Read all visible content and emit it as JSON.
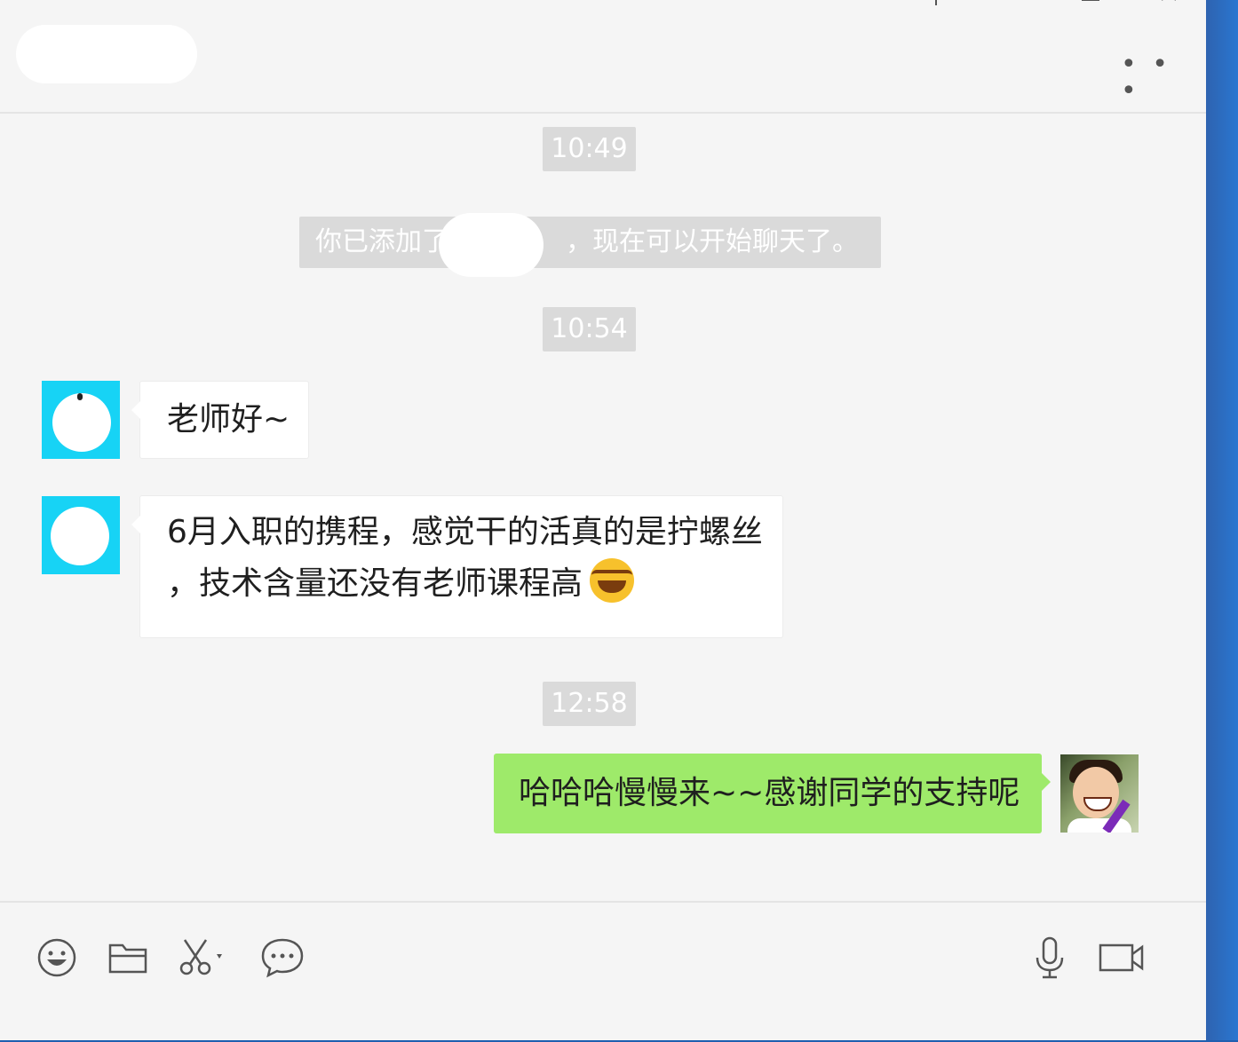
{
  "window": {
    "pin_icon": "pin-icon",
    "minimize_icon": "minimize-icon",
    "maximize_icon": "maximize-icon",
    "close_icon": "close-icon",
    "more_label": "• • •"
  },
  "messages": {
    "time_1": "10:49",
    "system_notice_prefix": "你已添加了",
    "system_notice_suffix": "，现在可以开始聊天了。",
    "time_2": "10:54",
    "msg_1": "老师好~",
    "msg_2_line1": "6月入职的携程，感觉干的活真的是拧螺丝",
    "msg_2_line2": "，技术含量还没有老师课程高",
    "emoji_msg_2": "laughing-tears-emoji",
    "time_3": "12:58",
    "msg_3": "哈哈哈慢慢来~~感谢同学的支持呢"
  },
  "toolbar": {
    "emoji": "emoji-icon",
    "file": "folder-icon",
    "screenshot": "scissors-icon",
    "chat_history": "chat-bubble-icon",
    "voice_call": "microphone-icon",
    "video_call": "video-camera-icon"
  },
  "colors": {
    "sent_bubble": "#9eea6a",
    "received_bubble": "#ffffff",
    "timestamp_bg": "#dadada",
    "avatar_bg": "#17d3f5",
    "chat_bg": "#f5f5f5"
  }
}
